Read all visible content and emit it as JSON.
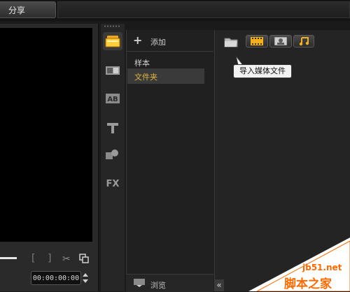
{
  "topbar": {
    "share_tab": "分享"
  },
  "preview": {
    "timecode": "00:00:00:00",
    "mark_in": "[",
    "mark_out": "]"
  },
  "library": {
    "add_label": "添加",
    "nav_items": [
      {
        "label": "样本"
      },
      {
        "label": "文件夹"
      }
    ],
    "browse_label": "浏览",
    "tooltip": "导入媒体文件",
    "collapse": "«"
  },
  "colors": {
    "accent": "#e6b63c",
    "watermark": "#ff6a00"
  },
  "watermark": {
    "site": "jb51.net",
    "text": "脚本之家"
  }
}
